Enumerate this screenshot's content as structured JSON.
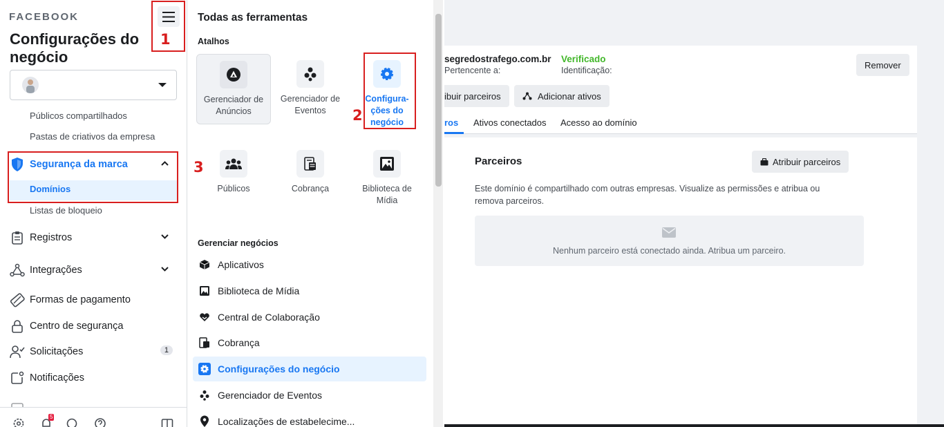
{
  "sidebar": {
    "brand": "FACEBOOK",
    "title": "Configurações do negócio",
    "sub_items_top": [
      "Públicos compartilhados",
      "Pastas de criativos da empresa"
    ],
    "brand_safety": "Segurança da marca",
    "domains": "Domínios",
    "block_lists": "Listas de bloqueio",
    "nav": {
      "records": "Registros",
      "integrations": "Integrações",
      "payment_methods": "Formas de pagamento",
      "security_center": "Centro de segurança",
      "requests": "Solicitações",
      "requests_count": "1",
      "notifications": "Notificações"
    },
    "footer_notif_count": "5"
  },
  "annotations": {
    "one": "1",
    "two": "2",
    "three": "3"
  },
  "tools": {
    "title": "Todas as ferramentas",
    "shortcuts_label": "Atalhos",
    "shortcuts": [
      "Gerenciador de Anúncios",
      "Gerenciador de Eventos",
      "Configura-ções do negócio",
      "Públicos",
      "Cobrança",
      "Biblioteca de Mídia"
    ],
    "manage_label": "Gerenciar negócios",
    "manage_items": [
      "Aplicativos",
      "Biblioteca de Mídia",
      "Central de Colaboração",
      "Cobrança",
      "Configurações do negócio",
      "Gerenciador de Eventos",
      "Localizações de estabelecime..."
    ]
  },
  "domain": {
    "name": "segredostrafego.com.br",
    "owner_label": "Pertencente a:",
    "status": "Verificado",
    "id_label": "Identificação:",
    "remove_btn": "Remover",
    "assign_partners_btn": "ibuir parceiros",
    "add_assets_btn": "Adicionar ativos",
    "tabs": [
      "ros",
      "Ativos conectados",
      "Acesso ao domínio"
    ]
  },
  "partners": {
    "title": "Parceiros",
    "assign_btn": "Atribuir parceiros",
    "description": "Este domínio é compartilhado com outras empresas. Visualize as permissões e atribua ou remova parceiros.",
    "empty": "Nenhum parceiro está conectado ainda. Atribua um parceiro."
  },
  "colors": {
    "accent": "#1877f2",
    "verified": "#42b72a",
    "annotation": "#d81e1e"
  }
}
